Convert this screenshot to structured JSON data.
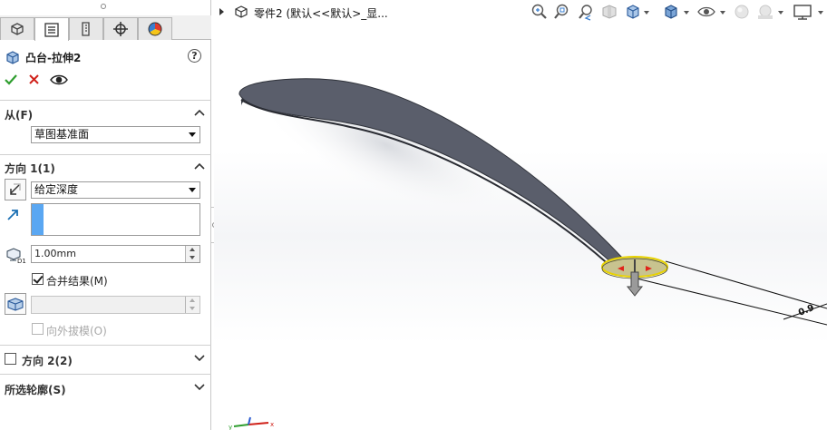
{
  "panel": {
    "tabs": [
      {
        "icon": "feature-manager-icon"
      },
      {
        "icon": "property-manager-icon"
      },
      {
        "icon": "configuration-manager-icon"
      },
      {
        "icon": "dimxpert-manager-icon"
      },
      {
        "icon": "display-manager-icon"
      }
    ],
    "feature_title": "凸台-拉伸2",
    "help_label": "?",
    "from_group": {
      "title": "从(F)",
      "selected": "草图基准面"
    },
    "direction1": {
      "title": "方向 1(1)",
      "end_condition": "给定深度",
      "depth_value": "1.00mm",
      "merge_label": "合并结果(M)",
      "merge_checked": true,
      "draft_label": "向外拔模(O)",
      "draft_checked": false,
      "draft_value": ""
    },
    "direction2": {
      "title": "方向 2(2)",
      "checked": false
    },
    "contours": {
      "title": "所选轮廓(S)"
    }
  },
  "viewport": {
    "part_title": "零件2  (默认<<默认>_显...",
    "toolbar": [
      {
        "icon": "zoom-to-fit-icon"
      },
      {
        "icon": "zoom-to-area-icon"
      },
      {
        "icon": "previous-view-icon"
      },
      {
        "icon": "section-view-icon"
      },
      {
        "icon": "view-orientation-icon"
      },
      {
        "icon": "display-style-icon"
      },
      {
        "icon": "hide-show-items-icon"
      },
      {
        "icon": "edit-appearance-icon"
      },
      {
        "icon": "apply-scene-icon"
      },
      {
        "icon": "view-settings-icon"
      }
    ],
    "dimension_label": "0.9"
  },
  "colors": {
    "model_face": "#5a5e6b",
    "model_edge": "#3a3d46",
    "profile_fill": "#c8c38f",
    "profile_edge": "#e8d200",
    "selection_blue": "#5aa7f2"
  }
}
